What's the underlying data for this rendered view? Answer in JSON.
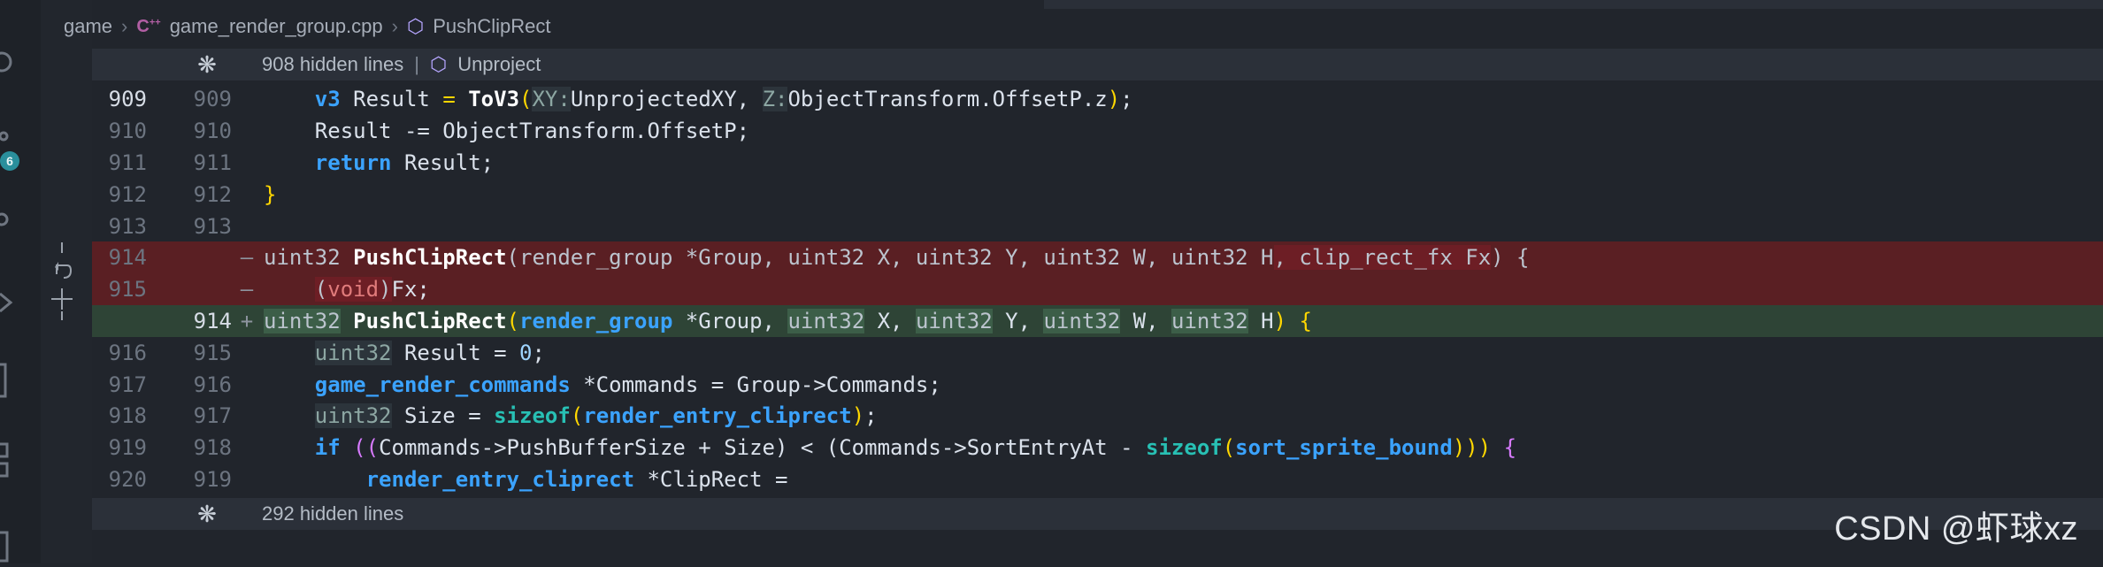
{
  "breadcrumb": {
    "folder": "game",
    "file": "game_render_group.cpp",
    "symbol": "PushClipRect",
    "file_icon": "cpp-icon",
    "symbol_icon": "cube-icon"
  },
  "activity": {
    "badge_count": "6"
  },
  "fold_top": {
    "label": "908 hidden lines",
    "separator": "|",
    "symbol": "Unproject"
  },
  "fold_bottom": {
    "label": "292 hidden lines"
  },
  "lines": [
    {
      "old": "909",
      "new": "909",
      "mark": "",
      "kind": "normal"
    },
    {
      "old": "910",
      "new": "910",
      "mark": "",
      "kind": "normal"
    },
    {
      "old": "911",
      "new": "911",
      "mark": "",
      "kind": "normal"
    },
    {
      "old": "912",
      "new": "912",
      "mark": "",
      "kind": "normal"
    },
    {
      "old": "913",
      "new": "913",
      "mark": "",
      "kind": "normal"
    },
    {
      "old": "914",
      "new": "",
      "mark": "—",
      "kind": "del"
    },
    {
      "old": "915",
      "new": "",
      "mark": "—",
      "kind": "del"
    },
    {
      "old": "",
      "new": "914",
      "mark": "+",
      "kind": "add"
    },
    {
      "old": "916",
      "new": "915",
      "mark": "",
      "kind": "normal"
    },
    {
      "old": "917",
      "new": "916",
      "mark": "",
      "kind": "normal"
    },
    {
      "old": "918",
      "new": "917",
      "mark": "",
      "kind": "normal"
    },
    {
      "old": "919",
      "new": "918",
      "mark": "",
      "kind": "normal"
    },
    {
      "old": "920",
      "new": "919",
      "mark": "",
      "kind": "normal"
    }
  ],
  "code": {
    "l909": {
      "kw": "v3",
      "var": "Result",
      "op": "=",
      "fn": "ToV3",
      "h1": "XY:",
      "a1": "UnprojectedXY,",
      "h2": "Z:",
      "a2": "ObjectTransform.OffsetP.z",
      "end": ";"
    },
    "l910": "Result -= ObjectTransform.OffsetP;",
    "l911": {
      "kw": "return",
      "rest": "Result;"
    },
    "l912": "}",
    "l914_del": {
      "t1": "uint32",
      "fn": "PushClipRect",
      "args": "(render_group *Group, uint32 X, uint32 Y, uint32 W, uint32 H",
      "extra": ", clip_rect_fx Fx",
      "end": ") {"
    },
    "l915_del": {
      "p1": "(",
      "kw": "void",
      "p2": ")",
      "rest": "Fx;"
    },
    "l914_add": {
      "t1": "uint32",
      "fn": "PushClipRect",
      "p1": "(",
      "t2": "render_group",
      "a1": "*Group,",
      "t3": "uint32",
      "a2": "X,",
      "t4": "uint32",
      "a3": "Y,",
      "t5": "uint32",
      "a4": "W,",
      "t6": "uint32",
      "a5": "H",
      "end": ") {"
    },
    "l915": {
      "t": "uint32",
      "rest": "Result = ",
      "num": "0",
      "end": ";"
    },
    "l916": {
      "t": "game_render_commands",
      "rest": "*Commands = Group->Commands;"
    },
    "l917": {
      "t": "uint32",
      "rest": "Size = ",
      "fn": "sizeof",
      "p1": "(",
      "arg": "render_entry_cliprect",
      "p2": ")",
      "end": ";"
    },
    "l918": {
      "kw": "if",
      "p1": "((",
      "a1": "Commands->PushBufferSize + Size) < (Commands->SortEntryAt - ",
      "fn": "sizeof",
      "p2": "(",
      "arg": "sort_sprite_bound",
      "p3": ")))",
      "end": " {"
    },
    "l919": {
      "t": "render_entry_cliprect",
      "rest": "*ClipRect ="
    }
  },
  "watermark": "CSDN @虾球xz"
}
